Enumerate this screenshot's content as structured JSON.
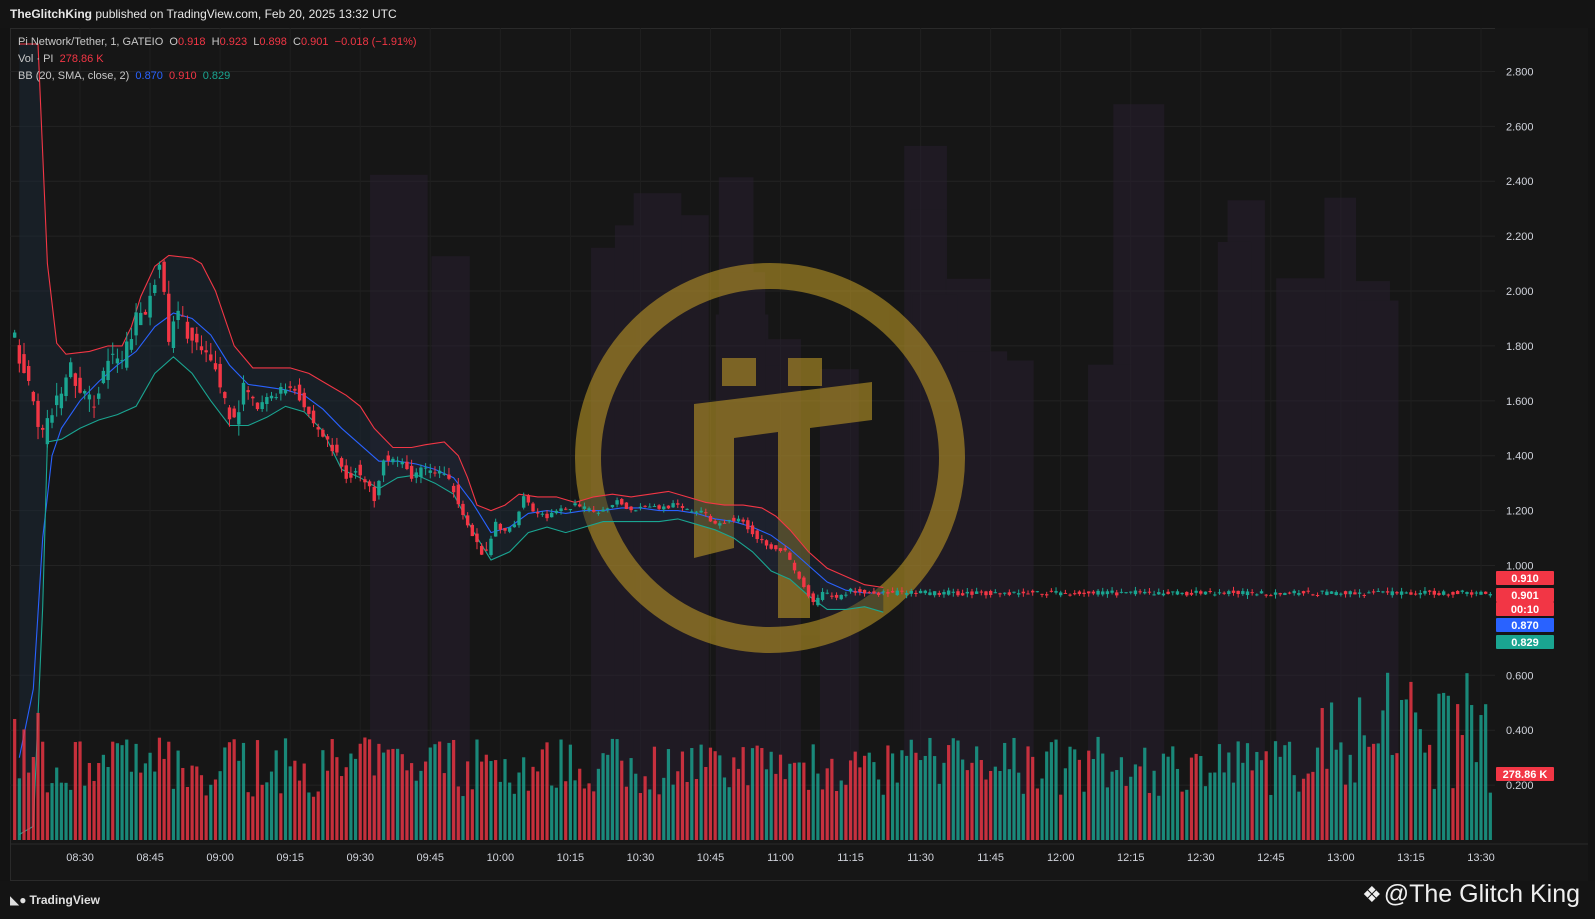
{
  "header": {
    "publisher": "TheGlitchKing",
    "published_text": "published on TradingView.com, Feb 20, 2025 13:32 UTC"
  },
  "legend": {
    "symbol": "Pi Network/Tether, 1, GATEIO",
    "o_label": "O",
    "o_value": "0.918",
    "h_label": "H",
    "h_value": "0.923",
    "l_label": "L",
    "l_value": "0.898",
    "c_label": "C",
    "c_value": "0.901",
    "change": "−0.018 (−1.91%)",
    "vol_label": "Vol · PI",
    "vol_value": "278.86 K",
    "bb_label": "BB (20, SMA, close, 2)",
    "bb_basis": "0.870",
    "bb_upper": "0.910",
    "bb_lower": "0.829"
  },
  "footer": {
    "brand": "TradingView",
    "brand_icon": "tradingview-logo-icon",
    "watermark": "@The Glitch King",
    "watermark_icon": "binance-diamond-icon"
  },
  "colors": {
    "up": "#1aa591",
    "down": "#f23645",
    "bb_upper": "#f23645",
    "bb_basis": "#2962ff",
    "bb_lower": "#1aa591",
    "logo": "#c9a227",
    "background": "#161616"
  },
  "chart_data": {
    "type": "candlestick",
    "title": "Pi Network/Tether, 1, GATEIO",
    "y_ticks": [
      "2.800",
      "2.600",
      "2.400",
      "2.200",
      "2.000",
      "1.800",
      "1.600",
      "1.400",
      "1.200",
      "1.000",
      "0.600",
      "0.400",
      "0.200"
    ],
    "ylim": [
      0.0,
      2.9
    ],
    "x_ticks": [
      "08:30",
      "08:45",
      "09:00",
      "09:15",
      "09:30",
      "09:45",
      "10:00",
      "10:15",
      "10:30",
      "10:45",
      "11:00",
      "11:15",
      "11:30",
      "11:45",
      "12:00",
      "12:15",
      "12:30",
      "12:45",
      "13:00",
      "13:15",
      "13:30"
    ],
    "x_tick_minutes": [
      510,
      525,
      540,
      555,
      570,
      585,
      600,
      615,
      630,
      645,
      660,
      675,
      690,
      705,
      720,
      735,
      750,
      765,
      780,
      795,
      810
    ],
    "x_range_minutes": [
      495,
      813
    ],
    "price_path": [
      [
        497,
        1.82
      ],
      [
        500,
        1.65
      ],
      [
        503,
        1.47
      ],
      [
        506,
        1.6
      ],
      [
        509,
        1.72
      ],
      [
        511,
        1.62
      ],
      [
        514,
        1.6
      ],
      [
        517,
        1.75
      ],
      [
        520,
        1.74
      ],
      [
        523,
        1.9
      ],
      [
        525,
        1.92
      ],
      [
        527,
        2.05
      ],
      [
        528,
        2.12
      ],
      [
        530,
        1.82
      ],
      [
        532,
        1.92
      ],
      [
        535,
        1.82
      ],
      [
        538,
        1.75
      ],
      [
        540,
        1.72
      ],
      [
        542,
        1.6
      ],
      [
        544,
        1.52
      ],
      [
        546,
        1.65
      ],
      [
        549,
        1.57
      ],
      [
        552,
        1.62
      ],
      [
        555,
        1.65
      ],
      [
        557,
        1.65
      ],
      [
        559,
        1.58
      ],
      [
        561,
        1.52
      ],
      [
        564,
        1.45
      ],
      [
        566,
        1.4
      ],
      [
        568,
        1.32
      ],
      [
        570,
        1.35
      ],
      [
        572,
        1.3
      ],
      [
        574,
        1.25
      ],
      [
        576,
        1.4
      ],
      [
        579,
        1.38
      ],
      [
        582,
        1.33
      ],
      [
        585,
        1.35
      ],
      [
        588,
        1.34
      ],
      [
        591,
        1.28
      ],
      [
        593,
        1.2
      ],
      [
        595,
        1.1
      ],
      [
        597,
        1.05
      ],
      [
        598,
        1.04
      ],
      [
        600,
        1.15
      ],
      [
        602,
        1.12
      ],
      [
        604,
        1.15
      ],
      [
        606,
        1.26
      ],
      [
        608,
        1.2
      ],
      [
        611,
        1.18
      ],
      [
        614,
        1.2
      ],
      [
        617,
        1.22
      ],
      [
        620,
        1.2
      ],
      [
        623,
        1.2
      ],
      [
        626,
        1.24
      ],
      [
        629,
        1.2
      ],
      [
        632,
        1.22
      ],
      [
        635,
        1.21
      ],
      [
        638,
        1.22
      ],
      [
        641,
        1.2
      ],
      [
        644,
        1.2
      ],
      [
        647,
        1.15
      ],
      [
        650,
        1.17
      ],
      [
        653,
        1.16
      ],
      [
        656,
        1.1
      ],
      [
        659,
        1.07
      ],
      [
        662,
        1.05
      ],
      [
        664,
        0.98
      ],
      [
        666,
        0.92
      ],
      [
        668,
        0.86
      ],
      [
        670,
        0.9
      ],
      [
        673,
        0.88
      ],
      [
        676,
        0.91
      ],
      [
        679,
        0.9
      ],
      [
        682,
        0.9
      ]
    ],
    "bb_upper": [
      [
        497,
        2.9
      ],
      [
        501,
        2.9
      ],
      [
        503,
        2.1
      ],
      [
        505,
        1.81
      ],
      [
        507,
        1.77
      ],
      [
        512,
        1.78
      ],
      [
        516,
        1.8
      ],
      [
        519,
        1.8
      ],
      [
        521,
        1.87
      ],
      [
        523,
        1.98
      ],
      [
        526,
        2.09
      ],
      [
        529,
        2.13
      ],
      [
        534,
        2.12
      ],
      [
        536,
        2.1
      ],
      [
        539,
        2.0
      ],
      [
        543,
        1.8
      ],
      [
        547,
        1.72
      ],
      [
        551,
        1.72
      ],
      [
        555,
        1.72
      ],
      [
        559,
        1.7
      ],
      [
        563,
        1.66
      ],
      [
        567,
        1.62
      ],
      [
        570,
        1.58
      ],
      [
        573,
        1.5
      ],
      [
        577,
        1.43
      ],
      [
        581,
        1.43
      ],
      [
        584,
        1.44
      ],
      [
        588,
        1.45
      ],
      [
        591,
        1.4
      ],
      [
        593,
        1.32
      ],
      [
        595,
        1.22
      ],
      [
        598,
        1.2
      ],
      [
        601,
        1.22
      ],
      [
        604,
        1.26
      ],
      [
        608,
        1.25
      ],
      [
        612,
        1.25
      ],
      [
        616,
        1.23
      ],
      [
        620,
        1.25
      ],
      [
        624,
        1.26
      ],
      [
        628,
        1.25
      ],
      [
        632,
        1.26
      ],
      [
        636,
        1.27
      ],
      [
        640,
        1.25
      ],
      [
        644,
        1.23
      ],
      [
        648,
        1.22
      ],
      [
        652,
        1.22
      ],
      [
        656,
        1.21
      ],
      [
        659,
        1.18
      ],
      [
        662,
        1.13
      ],
      [
        666,
        1.05
      ],
      [
        670,
        0.99
      ],
      [
        674,
        0.96
      ],
      [
        678,
        0.93
      ],
      [
        682,
        0.92
      ]
    ],
    "bb_basis": [
      [
        497,
        0.3
      ],
      [
        500,
        0.55
      ],
      [
        502,
        1.1
      ],
      [
        504,
        1.4
      ],
      [
        506,
        1.5
      ],
      [
        510,
        1.6
      ],
      [
        514,
        1.67
      ],
      [
        518,
        1.73
      ],
      [
        522,
        1.78
      ],
      [
        526,
        1.87
      ],
      [
        530,
        1.92
      ],
      [
        534,
        1.9
      ],
      [
        538,
        1.84
      ],
      [
        542,
        1.73
      ],
      [
        546,
        1.66
      ],
      [
        550,
        1.65
      ],
      [
        554,
        1.64
      ],
      [
        558,
        1.62
      ],
      [
        562,
        1.57
      ],
      [
        566,
        1.5
      ],
      [
        570,
        1.44
      ],
      [
        574,
        1.38
      ],
      [
        578,
        1.38
      ],
      [
        582,
        1.37
      ],
      [
        586,
        1.35
      ],
      [
        590,
        1.32
      ],
      [
        594,
        1.23
      ],
      [
        598,
        1.12
      ],
      [
        602,
        1.14
      ],
      [
        606,
        1.19
      ],
      [
        610,
        1.2
      ],
      [
        614,
        1.19
      ],
      [
        618,
        1.2
      ],
      [
        622,
        1.2
      ],
      [
        626,
        1.21
      ],
      [
        630,
        1.21
      ],
      [
        634,
        1.2
      ],
      [
        638,
        1.2
      ],
      [
        642,
        1.19
      ],
      [
        646,
        1.17
      ],
      [
        650,
        1.16
      ],
      [
        654,
        1.14
      ],
      [
        658,
        1.11
      ],
      [
        662,
        1.06
      ],
      [
        666,
        1.0
      ],
      [
        670,
        0.94
      ],
      [
        674,
        0.91
      ],
      [
        678,
        0.9
      ],
      [
        682,
        0.9
      ]
    ],
    "bb_lower": [
      [
        497,
        0.02
      ],
      [
        500,
        0.05
      ],
      [
        502,
        0.85
      ],
      [
        503,
        1.45
      ],
      [
        506,
        1.46
      ],
      [
        510,
        1.5
      ],
      [
        514,
        1.53
      ],
      [
        518,
        1.55
      ],
      [
        522,
        1.58
      ],
      [
        526,
        1.7
      ],
      [
        530,
        1.76
      ],
      [
        534,
        1.7
      ],
      [
        538,
        1.6
      ],
      [
        542,
        1.51
      ],
      [
        546,
        1.51
      ],
      [
        550,
        1.54
      ],
      [
        554,
        1.58
      ],
      [
        558,
        1.56
      ],
      [
        562,
        1.49
      ],
      [
        566,
        1.35
      ],
      [
        570,
        1.32
      ],
      [
        574,
        1.28
      ],
      [
        578,
        1.32
      ],
      [
        582,
        1.33
      ],
      [
        586,
        1.3
      ],
      [
        590,
        1.26
      ],
      [
        594,
        1.13
      ],
      [
        598,
        1.02
      ],
      [
        602,
        1.05
      ],
      [
        606,
        1.12
      ],
      [
        610,
        1.14
      ],
      [
        614,
        1.12
      ],
      [
        618,
        1.14
      ],
      [
        622,
        1.16
      ],
      [
        626,
        1.16
      ],
      [
        630,
        1.16
      ],
      [
        634,
        1.16
      ],
      [
        638,
        1.17
      ],
      [
        642,
        1.15
      ],
      [
        646,
        1.13
      ],
      [
        650,
        1.1
      ],
      [
        654,
        1.05
      ],
      [
        658,
        0.98
      ],
      [
        662,
        0.95
      ],
      [
        666,
        0.89
      ],
      [
        670,
        0.84
      ],
      [
        674,
        0.84
      ],
      [
        678,
        0.85
      ],
      [
        682,
        0.83
      ]
    ],
    "volume_max_k": 700,
    "last_values": {
      "bb_upper": "0.910",
      "close": "0.901",
      "countdown": "00:10",
      "bb_basis": "0.870",
      "bb_lower": "0.829",
      "volume": "278.86 K"
    }
  }
}
